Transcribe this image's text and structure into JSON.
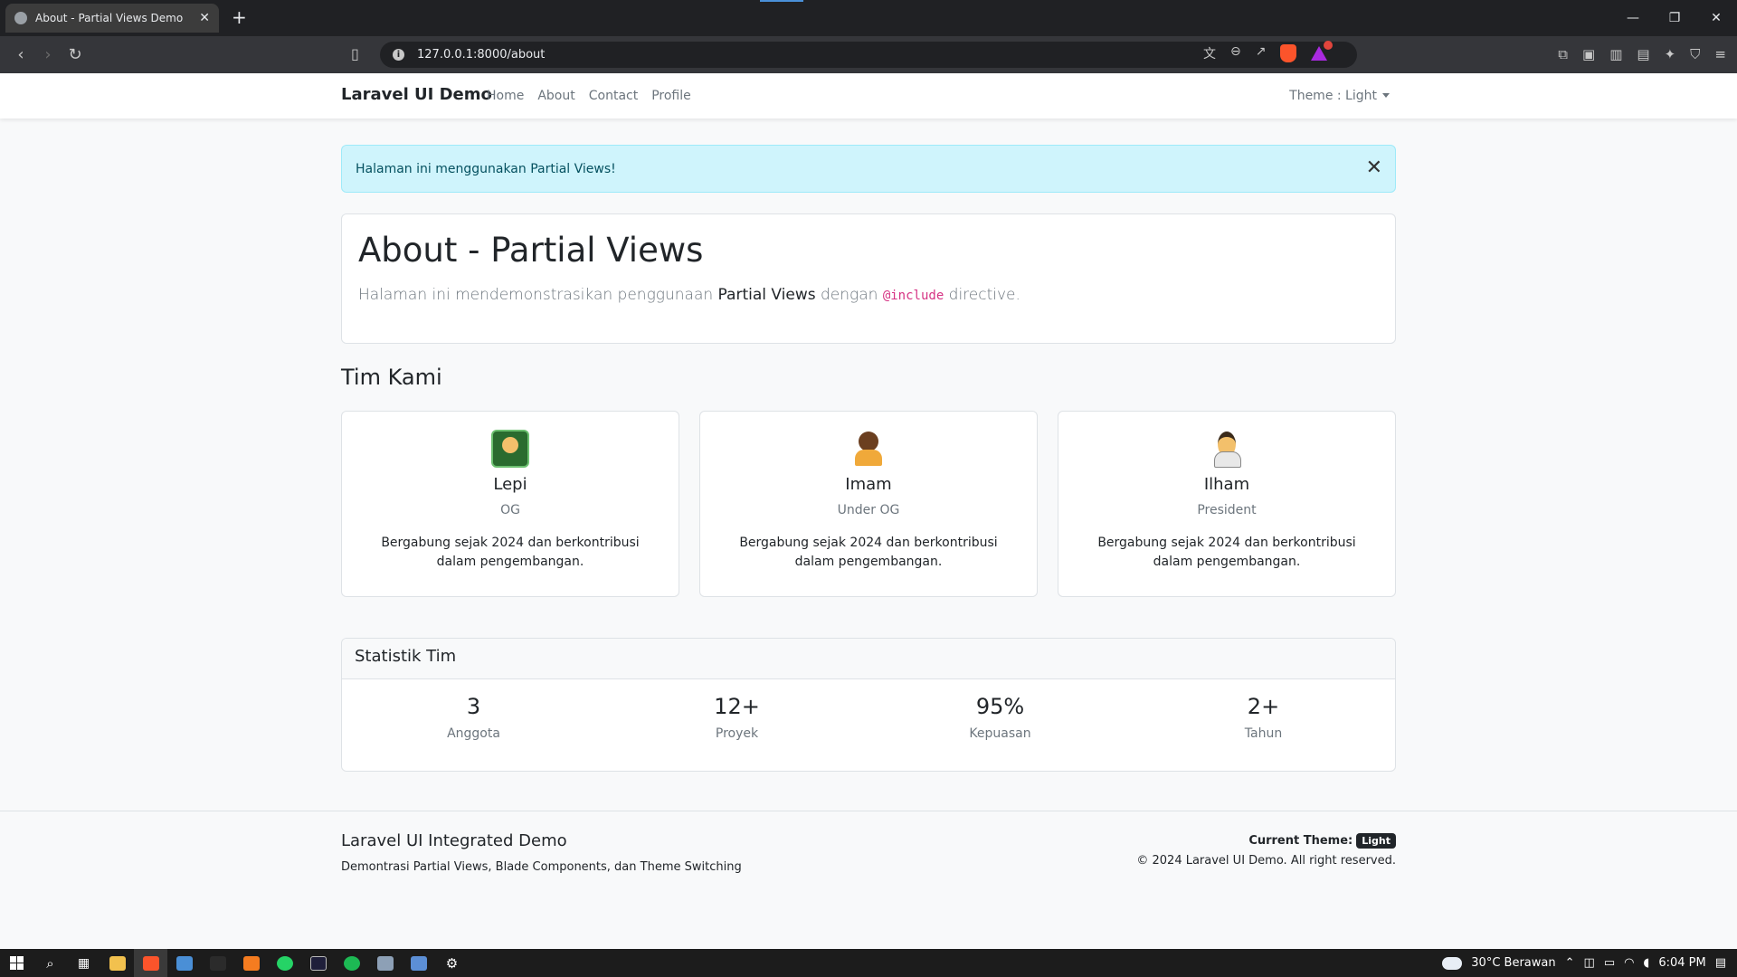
{
  "browser": {
    "tab_title": "About - Partial Views Demo",
    "tab_close": "✕",
    "new_tab": "+",
    "url": "127.0.0.1:8000/about",
    "window_controls": [
      "—",
      "❐",
      "✕"
    ],
    "ext_badge": "1"
  },
  "navbar": {
    "brand": "Laravel UI Demo",
    "links": [
      "Home",
      "About",
      "Contact",
      "Profile"
    ],
    "theme_label": "Theme : Light"
  },
  "alert": {
    "message": "Halaman ini menggunakan Partial Views!",
    "close": "✕"
  },
  "hero": {
    "title": "About - Partial Views",
    "text_before": "Halaman ini mendemonstrasikan penggunaan ",
    "highlight": "Partial Views",
    "text_middle": " dengan ",
    "code": "@include",
    "text_after": " directive."
  },
  "team": {
    "title": "Tim Kami",
    "members": [
      {
        "name": "Lepi",
        "role": "OG",
        "desc": "Bergabung sejak 2024 dan berkontribusi dalam pengembangan.",
        "icon": "technologist-emoji-icon"
      },
      {
        "name": "Imam",
        "role": "Under OG",
        "desc": "Bergabung sejak 2024 dan berkontribusi dalam pengembangan.",
        "icon": "ninja-emoji-icon"
      },
      {
        "name": "Ilham",
        "role": "President",
        "desc": "Bergabung sejak 2024 dan berkontribusi dalam pengembangan.",
        "icon": "office-worker-emoji-icon"
      }
    ]
  },
  "stats": {
    "title": "Statistik Tim",
    "items": [
      {
        "value": "3",
        "label": "Anggota"
      },
      {
        "value": "12+",
        "label": "Proyek"
      },
      {
        "value": "95%",
        "label": "Kepuasan"
      },
      {
        "value": "2+",
        "label": "Tahun"
      }
    ]
  },
  "footer": {
    "title": "Laravel UI Integrated Demo",
    "subtitle": "Demontrasi Partial Views, Blade Components, dan Theme Switching",
    "current_theme_label": "Current Theme:",
    "current_theme_badge": "Light",
    "copyright": "© 2024 Laravel UI Demo. All right reserved."
  },
  "taskbar": {
    "weather": "30°C  Berawan",
    "time": "6:04 PM"
  },
  "colors": {
    "alert_bg": "#cff4fc",
    "alert_text": "#055160",
    "code_pink": "#d63384",
    "brave_orange": "#fb542b"
  }
}
